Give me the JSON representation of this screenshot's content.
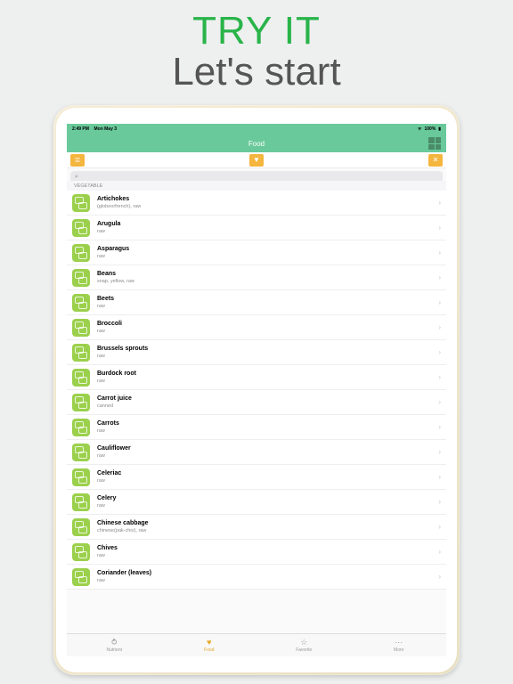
{
  "hero": {
    "line1": "TRY IT",
    "line2": "Let's start"
  },
  "status": {
    "time": "2:49 PM",
    "date": "Mon May 3",
    "battery": "100%"
  },
  "nav": {
    "title": "Food"
  },
  "search": {
    "glyph": "􀊫",
    "placeholder": ""
  },
  "section": {
    "header": "VEGETABLE"
  },
  "toolbar": {
    "sort_glyph": "≣",
    "filter_glyph": "▼",
    "close_glyph": "✕"
  },
  "rows": [
    {
      "title": "Artichokes",
      "sub": "(globeorfrench), raw"
    },
    {
      "title": "Arugula",
      "sub": "raw"
    },
    {
      "title": "Asparagus",
      "sub": "raw"
    },
    {
      "title": "Beans",
      "sub": "snap, yellow, raw"
    },
    {
      "title": "Beets",
      "sub": "raw"
    },
    {
      "title": "Broccoli",
      "sub": "raw"
    },
    {
      "title": "Brussels sprouts",
      "sub": "raw"
    },
    {
      "title": "Burdock root",
      "sub": "raw"
    },
    {
      "title": "Carrot juice",
      "sub": "canned"
    },
    {
      "title": "Carrots",
      "sub": "raw"
    },
    {
      "title": "Cauliflower",
      "sub": "raw"
    },
    {
      "title": "Celeriac",
      "sub": "raw"
    },
    {
      "title": "Celery",
      "sub": "raw"
    },
    {
      "title": "Chinese cabbage",
      "sub": "chinese(pak-choi), raw"
    },
    {
      "title": "Chives",
      "sub": "raw"
    },
    {
      "title": "Coriander (leaves)",
      "sub": "raw"
    }
  ],
  "tabs": [
    {
      "icon": "⥁",
      "label": "Nutrient"
    },
    {
      "icon": "♥",
      "label": "Food"
    },
    {
      "icon": "☆",
      "label": "Favorite"
    },
    {
      "icon": "⋯",
      "label": "More"
    }
  ],
  "active_tab_index": 1
}
